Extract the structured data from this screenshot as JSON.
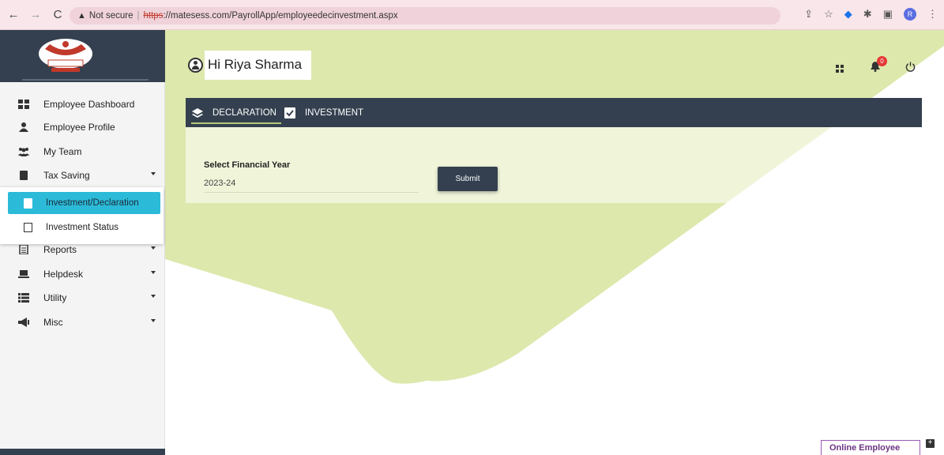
{
  "browser": {
    "warning": "Not secure",
    "url_scheme": "https",
    "url_rest": "://matesess.com/PayrollApp/employeedecinvestment.aspx",
    "profile_initial": "R"
  },
  "header": {
    "greeting": "Hi Riya Sharma",
    "notification_count": "0"
  },
  "sidebar": {
    "items": [
      {
        "label": "Employee Dashboard",
        "icon": "grid-icon"
      },
      {
        "label": "Employee Profile",
        "icon": "user-icon"
      },
      {
        "label": "My Team",
        "icon": "team-icon"
      },
      {
        "label": "Tax Saving",
        "icon": "book-icon",
        "expanded": true
      },
      {
        "label": "Reports",
        "icon": "report-icon"
      },
      {
        "label": "Helpdesk",
        "icon": "laptop-icon"
      },
      {
        "label": "Utility",
        "icon": "list-icon"
      },
      {
        "label": "Misc",
        "icon": "megaphone-icon"
      }
    ],
    "submenu": [
      {
        "label": "Investment/Declaration",
        "active": true
      },
      {
        "label": "Investment Status",
        "active": false
      }
    ]
  },
  "tabs": [
    {
      "label": "DECLARATION",
      "active": true,
      "icon": "layers-icon"
    },
    {
      "label": "INVESTMENT",
      "active": false,
      "icon": "check-shield-icon"
    }
  ],
  "form": {
    "fy_label": "Select Financial Year",
    "fy_value": "2023-24",
    "submit_label": "Submit"
  },
  "widget": {
    "online_label": "Online Employee"
  },
  "colors": {
    "navy": "#34404f",
    "accent_green": "#dde8ad",
    "active_cyan": "#2bbbd8",
    "badge_red": "#e53935"
  }
}
